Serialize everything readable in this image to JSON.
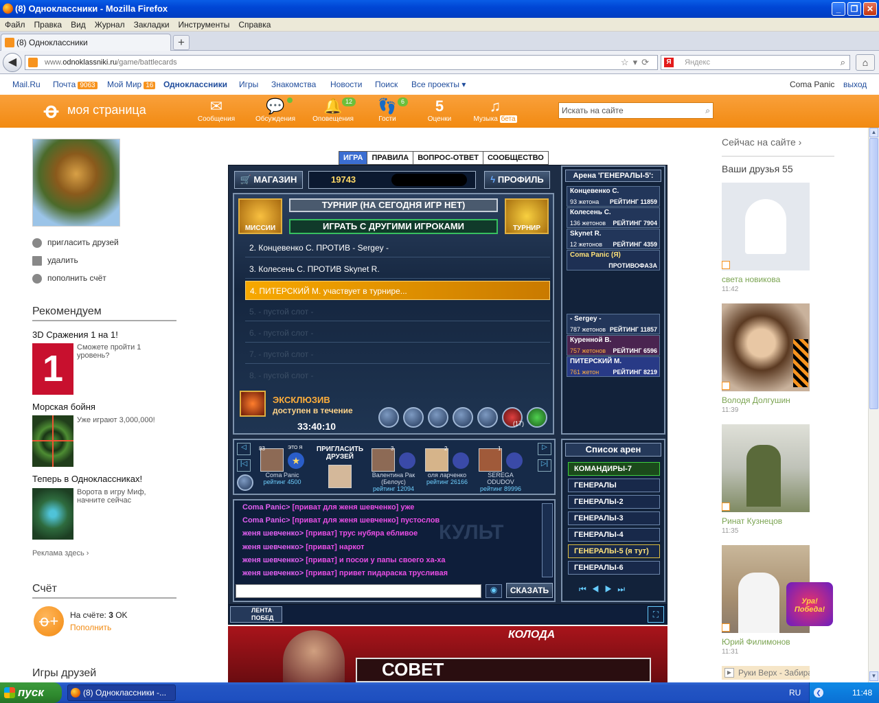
{
  "window": {
    "title": "(8) Одноклассники - Mozilla Firefox"
  },
  "menu": [
    "Файл",
    "Правка",
    "Вид",
    "Журнал",
    "Закладки",
    "Инструменты",
    "Справка"
  ],
  "tab": {
    "title": "(8) Одноклассники"
  },
  "url": {
    "prefix": "www.",
    "domain": "odnoklassniki.ru",
    "path": "/game/battlecards"
  },
  "search": {
    "placeholder": "Яндекс"
  },
  "toplinks": {
    "mailru": "Mail.Ru",
    "pochta": "Почта",
    "pochta_count": "9063",
    "moymir": "Мой Мир",
    "moymir_count": "16",
    "ok": "Одноклассники",
    "igry": "Игры",
    "znakomstva": "Знакомства",
    "novosti": "Новости",
    "poisk": "Поиск",
    "vse": "Все проекты ▾",
    "user": "Coma Panic",
    "exit": "выход"
  },
  "header": {
    "mypage": "моя страница",
    "nav": [
      {
        "label": "Сообщения",
        "icon": "envelope-icon",
        "glyph": "✉",
        "badge": ""
      },
      {
        "label": "Обсуждения",
        "icon": "discussions-icon",
        "glyph": "💬",
        "badge": ""
      },
      {
        "label": "Оповещения",
        "icon": "bell-icon",
        "glyph": "🔔",
        "badge": "12"
      },
      {
        "label": "Гости",
        "icon": "footprints-icon",
        "glyph": "👣",
        "badge": "6"
      },
      {
        "label": "Оценки",
        "icon": "rating-icon",
        "glyph": "5",
        "badge": ""
      },
      {
        "label": "Музыка",
        "icon": "music-icon",
        "glyph": "♫",
        "badge": "бета"
      }
    ],
    "site_search": "Искать на сайте"
  },
  "left": {
    "links": [
      "пригласить друзей",
      "удалить",
      "пополнить счёт"
    ],
    "recommend_title": "Рекомендуем",
    "promos": [
      {
        "title": "3D Сражения 1 на 1!",
        "text": "Сможете пройти 1 уровень?"
      },
      {
        "title": "Морская бойня",
        "text": "Уже играют 3,000,000!"
      },
      {
        "title": "Теперь в Одноклассниках!",
        "text": "Ворота в игру Миф, начните сейчас"
      }
    ],
    "ads": "Реклама здесь ›",
    "account_title": "Счёт",
    "balance_label": "На счёте:",
    "balance_value": "3",
    "balance_unit": "OK",
    "topup": "Пополнить",
    "friends_games": "Игры друзей"
  },
  "game": {
    "tabs": [
      "ИГРА",
      "ПРАВИЛА",
      "ВОПРОС-ОТВЕТ",
      "СООБЩЕСТВО"
    ],
    "shop": "МАГАЗИН",
    "coins": "19743",
    "profile": "ПРОФИЛЬ",
    "missions": "МИССИИ",
    "tournament": "ТУРНИР",
    "tournament_status": "ТУРНИР (НА СЕГОДНЯ ИГР НЕТ)",
    "play_others": "ИГРАТЬ С ДРУГИМИ ИГРОКАМИ",
    "rows": [
      "2. Концевенко С. ПРОТИВ - Sergey -",
      "3. Колесень С. ПРОТИВ Skynet R.",
      "4. ПИТЕРСКИЙ М. участвует в турнире...",
      "5. - пустой слот -",
      "6. - пустой слот -",
      "7. - пустой слот -",
      "8. - пустой слот -"
    ],
    "exclusive": "ЭКСКЛЮЗИВ",
    "available": "доступен в течение",
    "timer": "33:40:10",
    "gift_count": "(17)",
    "arena_title": "Арена 'ГЕНЕРАЛЫ-5':",
    "arena_players": [
      {
        "name": "Концевенко С.",
        "sub": "93 жетона",
        "rating": "РЕЙТИНГ 11859"
      },
      {
        "name": "Колесень С.",
        "sub": "136 жетонов",
        "rating": "РЕЙТИНГ 7904"
      },
      {
        "name": "Skynet R.",
        "sub": "12 жетонов",
        "rating": "РЕЙТИНГ 4359"
      },
      {
        "name": "Coma Panic (Я)",
        "sub": "",
        "rating": "ПРОТИВОФАЗА"
      },
      {
        "name": "- Sergey -",
        "sub": "787 жетонов",
        "rating": "РЕЙТИНГ 11857"
      },
      {
        "name": "Куренной В.",
        "sub": "757 жетонов",
        "rating": "РЕЙТИНГ 6596"
      },
      {
        "name": "ПИТЕРСКИЙ М.",
        "sub": "761 жетон",
        "rating": "РЕЙТИНГ 8219"
      }
    ],
    "friends_bar": [
      {
        "name": "Coma Panic",
        "rating": "рейтинг 4500",
        "level": "83",
        "tag": "ЭТО Я"
      },
      {
        "name": "ПРИГЛАСИТЬ ДРУЗЕЙ",
        "rating": "",
        "level": "",
        "tag": ""
      },
      {
        "name": "Валентина Рак (Белоус)",
        "rating": "рейтинг 12094",
        "level": "3",
        "tag": ""
      },
      {
        "name": "оля ларченко",
        "rating": "рейтинг 26166",
        "level": "2",
        "tag": ""
      },
      {
        "name": "SEREGA ODUDOV",
        "rating": "рейтинг 89996",
        "level": "1",
        "tag": ""
      }
    ],
    "arena_list_title": "Список арен",
    "arenas": [
      "КОМАНДИРЫ-7",
      "ГЕНЕРАЛЫ",
      "ГЕНЕРАЛЫ-2",
      "ГЕНЕРАЛЫ-3",
      "ГЕНЕРАЛЫ-4",
      "ГЕНЕРАЛЫ-5 (я тут)",
      "ГЕНЕРАЛЫ-6"
    ],
    "chat": [
      {
        "from": "Coma Panic>",
        "msg": "[приват для женя шевченко] уже"
      },
      {
        "from": "Coma Panic>",
        "msg": "[приват для женя шевченко] пустослов"
      },
      {
        "from": "женя шевченко>",
        "msg": "[приват] трус нубяра ебливое"
      },
      {
        "from": "женя шевченко>",
        "msg": "[приват] наркот"
      },
      {
        "from": "женя шевченко>",
        "msg": "[приват] и посои у папы своего ха-ха"
      },
      {
        "from": "женя шевченко>",
        "msg": "[приват] привет пидараска трусливая"
      }
    ],
    "chat_watermark": "КУЛЬТ",
    "say": "СКАЗАТЬ",
    "feed": "ЛЕНТА ПОБЕД",
    "deck": "КОЛОДА",
    "advice": "СОВЕТ"
  },
  "right": {
    "online": "Сейчас на сайте ›",
    "friends": "Ваши друзья 55",
    "list": [
      {
        "name": "света новикова",
        "time": "11:42"
      },
      {
        "name": "Володя Долгушин",
        "time": "11:39"
      },
      {
        "name": "Ринат Кузнецов",
        "time": "11:35"
      },
      {
        "name": "Юрий Филимонов",
        "time": "11:31"
      }
    ],
    "victory": "Ура! Победа!",
    "music": "Руки Верх - Забира"
  },
  "taskbar": {
    "start": "пуск",
    "item": "(8) Одноклассники -...",
    "lang": "RU",
    "time": "11:48"
  }
}
